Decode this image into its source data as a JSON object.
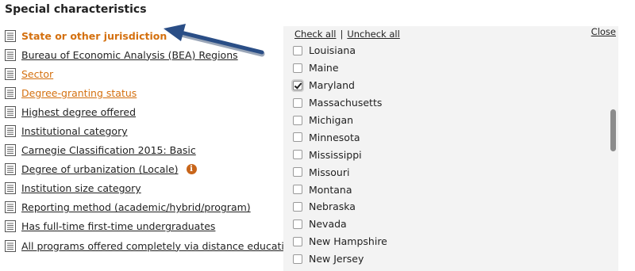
{
  "heading": "Special characteristics",
  "items": [
    {
      "label": "State or other jurisdiction",
      "style": "active"
    },
    {
      "label": "Bureau of Economic Analysis (BEA) Regions",
      "style": "normal"
    },
    {
      "label": "Sector",
      "style": "orange"
    },
    {
      "label": "Degree-granting status",
      "style": "orange"
    },
    {
      "label": "Highest degree offered",
      "style": "normal"
    },
    {
      "label": "Institutional category",
      "style": "normal"
    },
    {
      "label": "Carnegie Classification 2015: Basic",
      "style": "normal"
    },
    {
      "label": "Degree of urbanization (Locale)",
      "style": "normal",
      "info": "i"
    },
    {
      "label": "Institution size category",
      "style": "normal"
    },
    {
      "label": "Reporting method (academic/hybrid/program)",
      "style": "normal"
    },
    {
      "label": "Has full-time first-time undergraduates",
      "style": "normal"
    },
    {
      "label": "All programs offered completely via distance education",
      "style": "normal"
    }
  ],
  "panel": {
    "check_all": "Check all",
    "separator": "|",
    "uncheck_all": "Uncheck all",
    "close": "Close",
    "states": [
      {
        "name": "Louisiana",
        "checked": false
      },
      {
        "name": "Maine",
        "checked": false
      },
      {
        "name": "Maryland",
        "checked": true
      },
      {
        "name": "Massachusetts",
        "checked": false
      },
      {
        "name": "Michigan",
        "checked": false
      },
      {
        "name": "Minnesota",
        "checked": false
      },
      {
        "name": "Mississippi",
        "checked": false
      },
      {
        "name": "Missouri",
        "checked": false
      },
      {
        "name": "Montana",
        "checked": false
      },
      {
        "name": "Nebraska",
        "checked": false
      },
      {
        "name": "Nevada",
        "checked": false
      },
      {
        "name": "New Hampshire",
        "checked": false
      },
      {
        "name": "New Jersey",
        "checked": false
      }
    ]
  },
  "colors": {
    "accent_orange": "#d4700f",
    "arrow_blue": "#2a4e86",
    "panel_bg": "#f3f3f3"
  }
}
